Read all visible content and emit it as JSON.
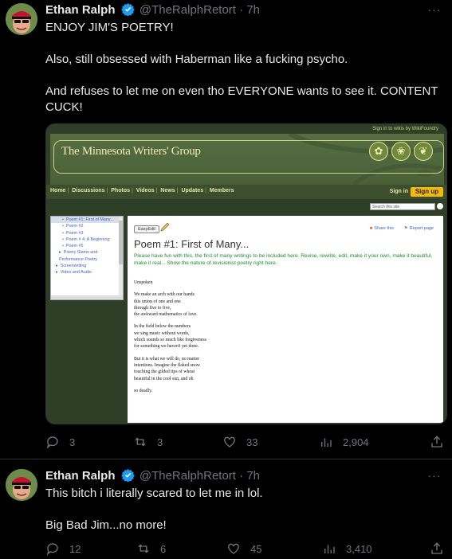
{
  "tweets": [
    {
      "author": "Ethan Ralph",
      "handle": "@TheRalphRetort",
      "separator": "·",
      "time": "7h",
      "lines": [
        "ENJOY JIM'S POETRY!",
        "",
        "Also, still obsessed with Haberman like a fucking psycho.",
        "",
        "And refuses to let me on even tho EVERYONE wants to see it. CONTENT CUCK!"
      ],
      "stats": {
        "replies": "3",
        "reposts": "3",
        "likes": "33",
        "views": "2,904"
      }
    },
    {
      "author": "Ethan Ralph",
      "handle": "@TheRalphRetort",
      "separator": "·",
      "time": "7h",
      "lines": [
        "This bitch i literally scared to let me in lol.",
        "",
        "Big Bad Jim...no more!"
      ],
      "stats": {
        "replies": "12",
        "reposts": "6",
        "likes": "45",
        "views": "3,410"
      }
    }
  ],
  "more_icon_glyph": "···",
  "embedded_screenshot": {
    "wikifoundry_link": "Sign in to wikis by WikiFoundry",
    "site_title": "The Minnesota Writers' Group",
    "nav": [
      "Home",
      "Discussions",
      "Photos",
      "Videos",
      "News",
      "Updates",
      "Members"
    ],
    "nav_separator": "|",
    "sign_in": "Sign in",
    "sign_up": "Sign up",
    "search_placeholder": "Search this site",
    "sidebar": [
      {
        "label": "Poem #1: First of Many...",
        "kind": "sub",
        "selected": true
      },
      {
        "label": "Poem #2",
        "kind": "sub"
      },
      {
        "label": "Poem #3",
        "kind": "sub"
      },
      {
        "label": "Poem # 4: A Beginning",
        "kind": "sub"
      },
      {
        "label": "Poem #5",
        "kind": "sub"
      },
      {
        "label": "Poetry Slams and Performance Poetry",
        "kind": "top"
      },
      {
        "label": "Screenwriting",
        "kind": "sec"
      },
      {
        "label": "Video and Audio",
        "kind": "sec"
      }
    ],
    "easyedit_label": "EasyEdit",
    "share_label": "Share this",
    "report_label": "Report page",
    "page_title": "Poem #1: First of Many...",
    "intro": "Please have fun with this, the first of many writings to be included here. Revise, rewrite, edit, make it your own, make it beautiful, make it real... Show the nature of revisionist poetry right here.",
    "poem_stanzas": [
      [
        "Unspoken"
      ],
      [
        "We make an arch with our hands",
        "this union of one and one",
        "through five to five,",
        "the awkward mathematics of love."
      ],
      [
        "In the field below the numbers",
        "we sing music without words,",
        "which sounds so much like forgiveness",
        "for something we haven't yet done."
      ],
      [
        "But it is what we will do, no matter",
        "intentions. Imagine the flaked snow",
        "touching the gilded tips of wheat",
        "beautiful in the cool sun, and oh"
      ],
      [
        "so deadly."
      ]
    ]
  },
  "colors": {
    "background": "#000000",
    "text_primary": "#e7e9ea",
    "text_secondary": "#71767b",
    "verified_blue": "#1d9bf0",
    "divider": "#2f3336",
    "signup_yellow": "#f5b90a",
    "intro_green": "#1a8b2c"
  }
}
